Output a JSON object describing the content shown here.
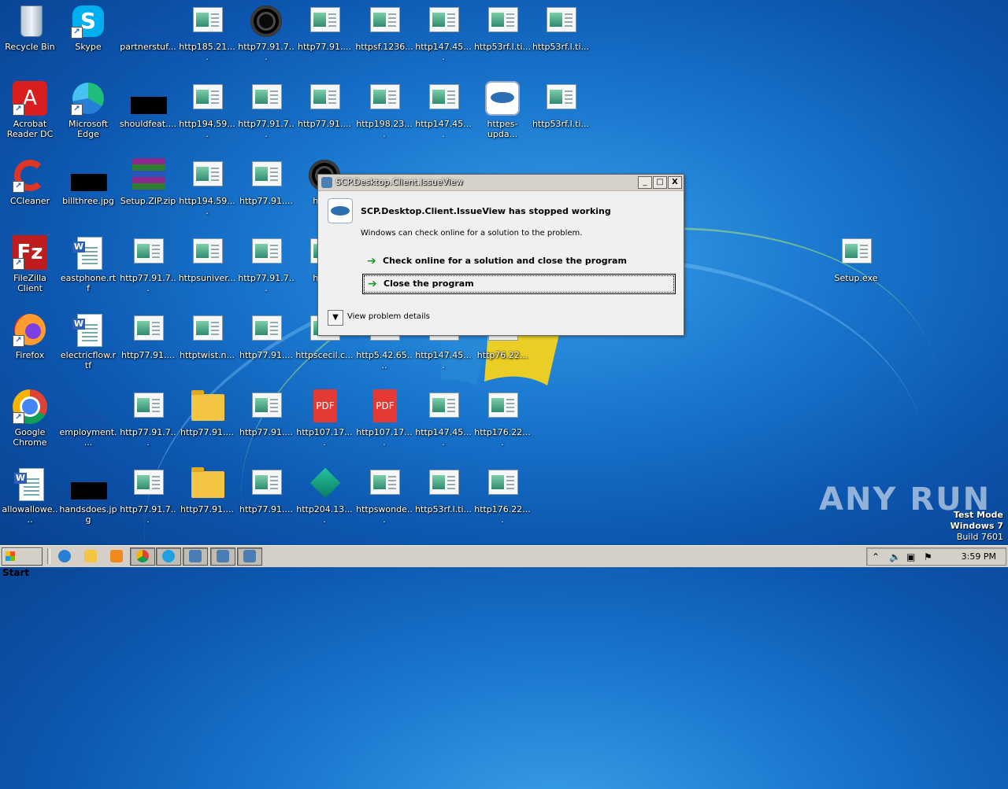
{
  "desktop": {
    "icons": [
      {
        "label": "Recycle Bin",
        "icon": "recycle-bin-icon"
      },
      {
        "label": "Skype",
        "icon": "skype-icon"
      },
      {
        "label": "partnerstuf...",
        "icon": "blank-file-icon"
      },
      {
        "label": "http185.21....",
        "icon": "generic-file-icon"
      },
      {
        "label": "http77.91.7...",
        "icon": "circle-app-icon"
      },
      {
        "label": "http77.91....",
        "icon": "generic-file-icon"
      },
      {
        "label": "httpsf.1236...",
        "icon": "generic-file-icon"
      },
      {
        "label": "http147.45....",
        "icon": "generic-file-icon"
      },
      {
        "label": "http53rf.l.ti...",
        "icon": "generic-file-icon"
      },
      {
        "label": "http53rf.l.ti...",
        "icon": "generic-file-icon"
      },
      {
        "label": "Acrobat Reader DC",
        "icon": "acrobat-icon"
      },
      {
        "label": "Microsoft Edge",
        "icon": "edge-icon"
      },
      {
        "label": "shouldfeat....",
        "icon": "black-image-icon"
      },
      {
        "label": "http194.59....",
        "icon": "generic-file-icon"
      },
      {
        "label": "http77.91.7...",
        "icon": "generic-file-icon"
      },
      {
        "label": "http77.91....",
        "icon": "generic-file-icon"
      },
      {
        "label": "http198.23....",
        "icon": "generic-file-icon"
      },
      {
        "label": "http147.45....",
        "icon": "generic-file-icon"
      },
      {
        "label": "httpes-upda...",
        "icon": "fish-app-icon"
      },
      {
        "label": "http53rf.l.ti...",
        "icon": "generic-file-icon"
      },
      {
        "label": "CCleaner",
        "icon": "ccleaner-icon"
      },
      {
        "label": "billthree.jpg",
        "icon": "black-image-icon"
      },
      {
        "label": "Setup.ZIP.zip",
        "icon": "winrar-icon"
      },
      {
        "label": "http194.59....",
        "icon": "generic-file-icon"
      },
      {
        "label": "http77.91....",
        "icon": "generic-file-icon"
      },
      {
        "label": "http7",
        "icon": "circle-app-icon"
      },
      {
        "label": "FileZilla Client",
        "icon": "filezilla-icon"
      },
      {
        "label": "eastphone.rtf",
        "icon": "word-doc-icon"
      },
      {
        "label": "http77.91.7...",
        "icon": "generic-file-icon"
      },
      {
        "label": "httpsuniver...",
        "icon": "generic-file-icon"
      },
      {
        "label": "http77.91.7...",
        "icon": "generic-file-icon"
      },
      {
        "label": "http1",
        "icon": "generic-file-icon"
      },
      {
        "label": "Setup.exe",
        "icon": "generic-file-icon"
      },
      {
        "label": "Firefox",
        "icon": "firefox-icon"
      },
      {
        "label": "electricflow.rtf",
        "icon": "word-doc-icon"
      },
      {
        "label": "http77.91....",
        "icon": "generic-file-icon"
      },
      {
        "label": "httptwist.n...",
        "icon": "generic-file-icon"
      },
      {
        "label": "http77.91....",
        "icon": "generic-file-icon"
      },
      {
        "label": "httpscecil.c...",
        "icon": "generic-file-icon"
      },
      {
        "label": "http5.42.65....",
        "icon": "generic-file-icon"
      },
      {
        "label": "http147.45....",
        "icon": "generic-file-icon"
      },
      {
        "label": "http76.22...",
        "icon": "generic-file-icon"
      },
      {
        "label": "Google Chrome",
        "icon": "chrome-icon"
      },
      {
        "label": "employment....",
        "icon": "blank-file-icon"
      },
      {
        "label": "http77.91.7...",
        "icon": "generic-file-icon"
      },
      {
        "label": "http77.91....",
        "icon": "folder-icon"
      },
      {
        "label": "http77.91....",
        "icon": "generic-file-icon"
      },
      {
        "label": "http107.17....",
        "icon": "pdf-icon"
      },
      {
        "label": "http107.17....",
        "icon": "pdf-icon"
      },
      {
        "label": "http147.45....",
        "icon": "generic-file-icon"
      },
      {
        "label": "http176.22....",
        "icon": "generic-file-icon"
      },
      {
        "label": "allowallowe....",
        "icon": "word-doc-icon"
      },
      {
        "label": "handsdoes.jpg",
        "icon": "black-image-icon"
      },
      {
        "label": "http77.91.7...",
        "icon": "generic-file-icon"
      },
      {
        "label": "http77.91....",
        "icon": "folder-icon"
      },
      {
        "label": "http77.91....",
        "icon": "generic-file-icon"
      },
      {
        "label": "http204.13....",
        "icon": "package-icon"
      },
      {
        "label": "httpswonde...",
        "icon": "generic-file-icon"
      },
      {
        "label": "http53rf.l.ti...",
        "icon": "generic-file-icon"
      },
      {
        "label": "http176.22....",
        "icon": "generic-file-icon"
      }
    ]
  },
  "dialog": {
    "title": "SCP.Desktop.Client.IssueView",
    "heading": "SCP.Desktop.Client.IssueView has stopped working",
    "subtext": "Windows can check online for a solution to the problem.",
    "option_check": "Check online for a solution and close the program",
    "option_close": "Close the program",
    "details_label": "View problem details",
    "btn_min": "_",
    "btn_max": "□",
    "btn_close": "X"
  },
  "watermark": {
    "text": "ANY RUN",
    "test_mode": "Test Mode",
    "os": "Windows 7",
    "build": "Build 7601"
  },
  "taskbar": {
    "start_label": "Start",
    "clock": "3:59 PM"
  }
}
